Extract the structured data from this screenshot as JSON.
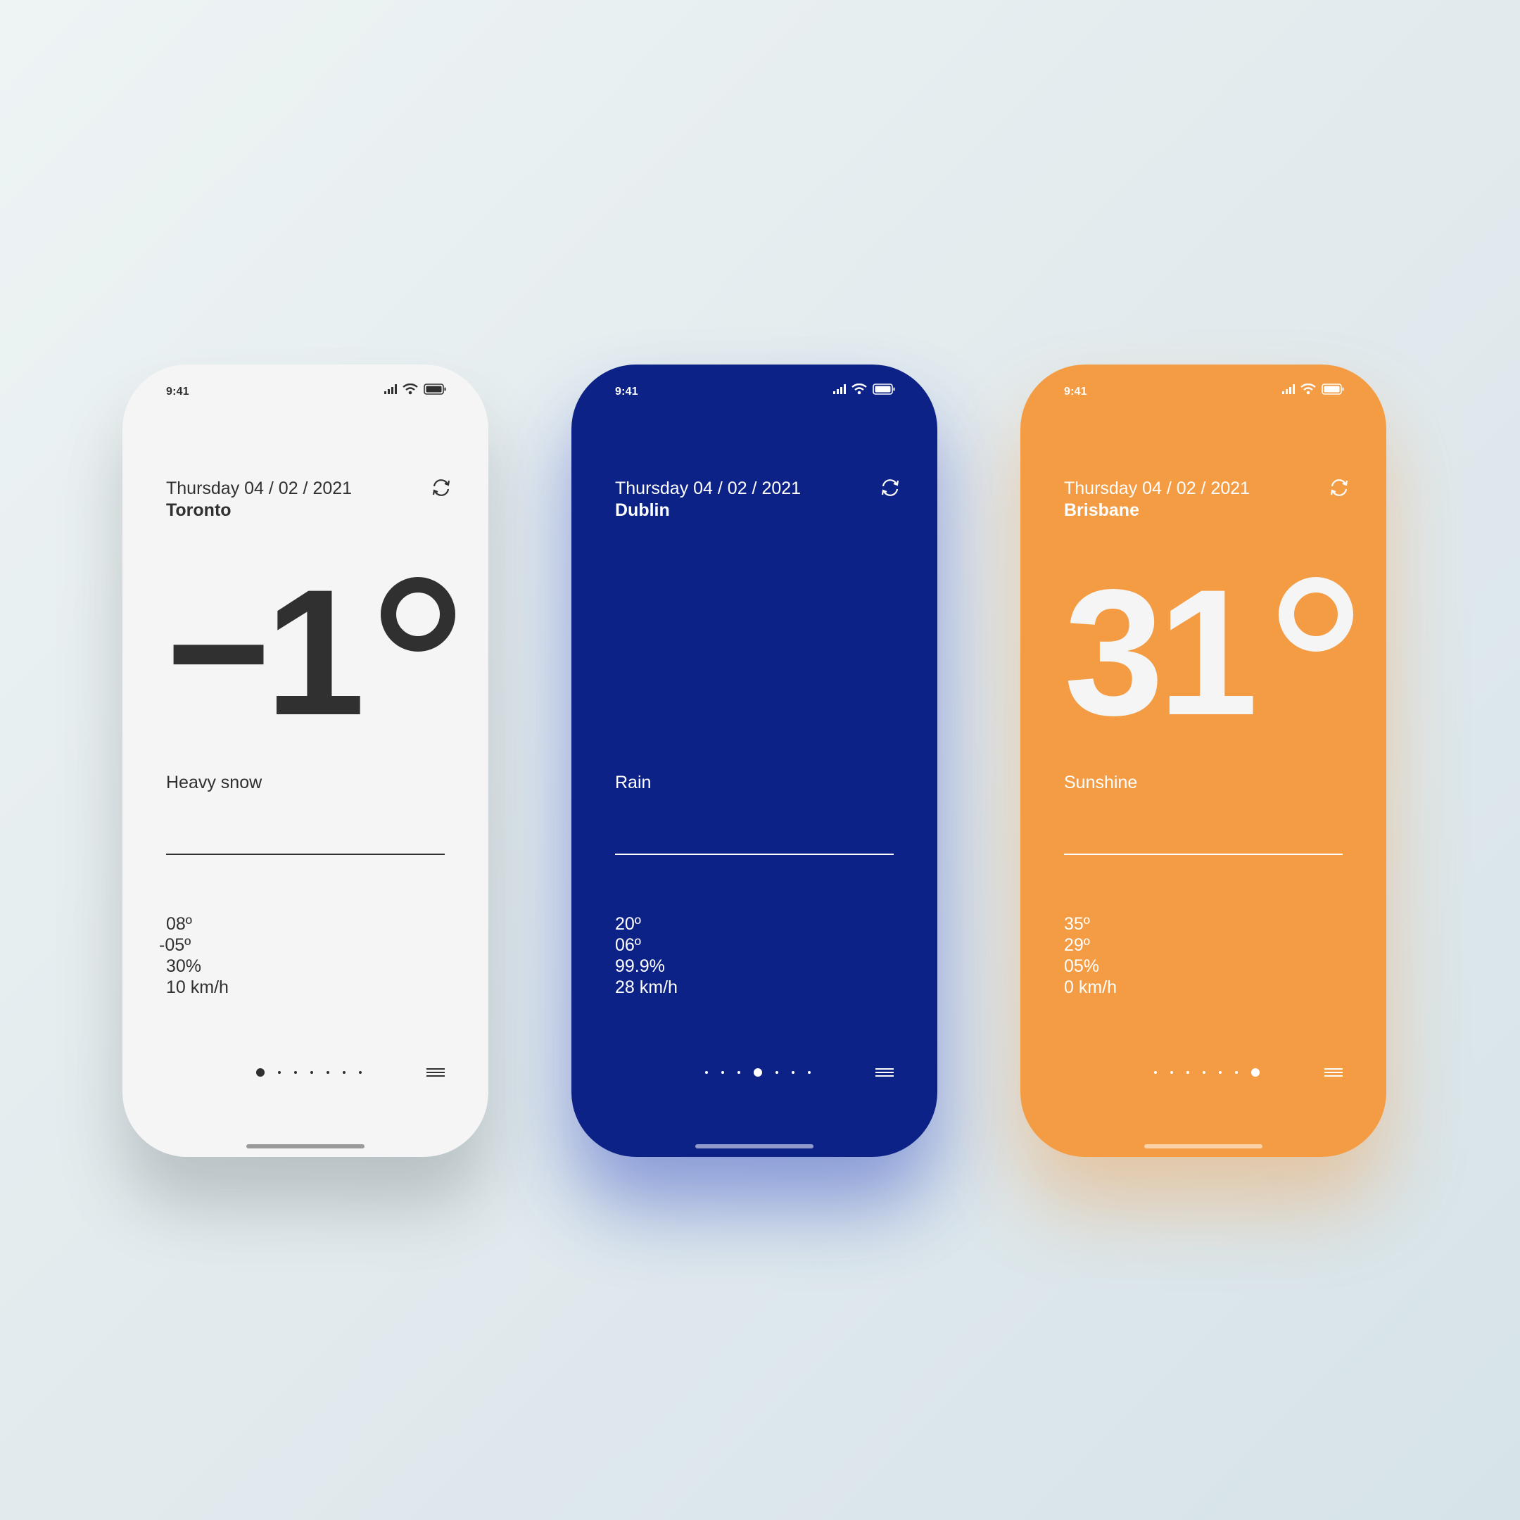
{
  "phones": [
    {
      "theme": "light",
      "background": "#f5f5f5",
      "text_color": "#303030",
      "status_time": "9:41",
      "date": "Thursday 04 / 02 / 2021",
      "city": "Toronto",
      "temperature": "−1",
      "condition": "Heavy snow",
      "stats": [
        "08º",
        "-05º",
        "30%",
        "10 km/h"
      ],
      "page_count": 7,
      "active_page": 1,
      "icons": [
        "signal-icon",
        "wifi-icon",
        "battery-icon",
        "refresh-icon",
        "menu-icon"
      ]
    },
    {
      "theme": "blue",
      "background": "#0c2287",
      "text_color": "#ffffff",
      "status_time": "9:41",
      "date": "Thursday 04 / 02 / 2021",
      "city": "Dublin",
      "temperature": "",
      "condition": "Rain",
      "stats": [
        "20º",
        "06º",
        "99.9%",
        "28 km/h"
      ],
      "page_count": 7,
      "active_page": 4,
      "icons": [
        "signal-icon",
        "wifi-icon",
        "battery-icon",
        "refresh-icon",
        "menu-icon"
      ]
    },
    {
      "theme": "orange",
      "background": "#f49c43",
      "text_color": "#ffffff",
      "status_time": "9:41",
      "date": "Thursday 04 / 02 / 2021",
      "city": "Brisbane",
      "temperature": "31",
      "condition": "Sunshine",
      "stats": [
        "35º",
        "29º",
        "05%",
        "0 km/h"
      ],
      "page_count": 7,
      "active_page": 7,
      "icons": [
        "signal-icon",
        "wifi-icon",
        "battery-icon",
        "refresh-icon",
        "menu-icon"
      ]
    }
  ]
}
